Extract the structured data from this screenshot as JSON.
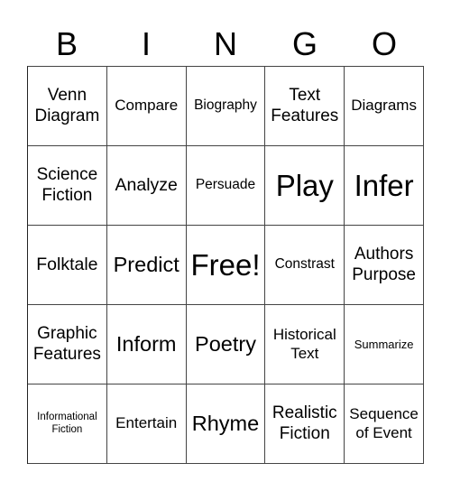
{
  "header": [
    "B",
    "I",
    "N",
    "G",
    "O"
  ],
  "cells": [
    [
      {
        "text": "Venn Diagram",
        "size": "l"
      },
      {
        "text": "Compare",
        "size": "m"
      },
      {
        "text": "Biography",
        "size": "s"
      },
      {
        "text": "Text Features",
        "size": "l"
      },
      {
        "text": "Diagrams",
        "size": "m"
      }
    ],
    [
      {
        "text": "Science Fiction",
        "size": "l"
      },
      {
        "text": "Analyze",
        "size": "ml"
      },
      {
        "text": "Persuade",
        "size": "s"
      },
      {
        "text": "Play",
        "size": "xxl"
      },
      {
        "text": "Infer",
        "size": "xxl"
      }
    ],
    [
      {
        "text": "Folktale",
        "size": "ml"
      },
      {
        "text": "Predict",
        "size": "xl"
      },
      {
        "text": "Free!",
        "size": "xxl"
      },
      {
        "text": "Constrast",
        "size": "s"
      },
      {
        "text": "Authors Purpose",
        "size": "l"
      }
    ],
    [
      {
        "text": "Graphic Features",
        "size": "l"
      },
      {
        "text": "Inform",
        "size": "xl"
      },
      {
        "text": "Poetry",
        "size": "xl"
      },
      {
        "text": "Historical Text",
        "size": "m"
      },
      {
        "text": "Summarize",
        "size": "xs"
      }
    ],
    [
      {
        "text": "Informational Fiction",
        "size": "xxs"
      },
      {
        "text": "Entertain",
        "size": "m"
      },
      {
        "text": "Rhyme",
        "size": "xl"
      },
      {
        "text": "Realistic Fiction",
        "size": "l"
      },
      {
        "text": "Sequence of Event",
        "size": "m"
      }
    ]
  ]
}
